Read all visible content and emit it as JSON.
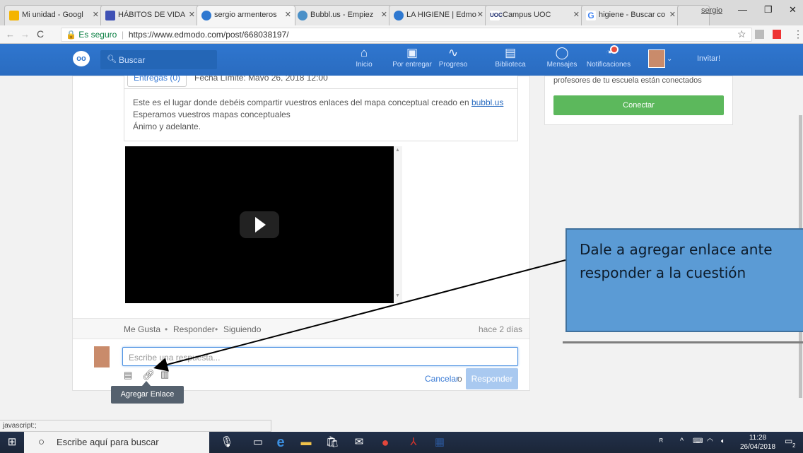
{
  "browser": {
    "tabs": [
      {
        "label": "Mi unidad - Googl",
        "icon": "drive-icon",
        "color": "#1fa463"
      },
      {
        "label": "HÁBITOS DE VIDA",
        "icon": "forms-icon",
        "color": "#3f51b5"
      },
      {
        "label": "sergio armenteros",
        "icon": "edmodo-icon",
        "color": "#2e78d0"
      },
      {
        "label": "Bubbl.us - Empiez",
        "icon": "bubbl-icon",
        "color": "#4a90c8"
      },
      {
        "label": "LA HIGIENE | Edmo",
        "icon": "edmodo-icon",
        "color": "#2e78d0"
      },
      {
        "label": "Campus UOC",
        "icon": "uoc-icon",
        "color": "#1a2a6c"
      },
      {
        "label": "higiene - Buscar co",
        "icon": "google-icon",
        "color": "#4285f4"
      }
    ],
    "user": "sergio",
    "secure_label": "Es seguro",
    "url": "https://www.edmodo.com/post/668038197/",
    "status_text": "javascript:;"
  },
  "nav": {
    "search_placeholder": "Buscar",
    "items": [
      {
        "label": "Inicio",
        "icon": "home-icon"
      },
      {
        "label": "Por entregar",
        "icon": "assignment-icon"
      },
      {
        "label": "Progreso",
        "icon": "progress-icon"
      },
      {
        "label": "Biblioteca",
        "icon": "library-icon"
      },
      {
        "label": "Mensajes",
        "icon": "message-icon"
      },
      {
        "label": "Notificaciones",
        "icon": "bell-icon"
      }
    ],
    "invite": "Invitar!"
  },
  "post": {
    "submissions_btn": "Entregas (0)",
    "due_date": "Fecha Límite: Mayo 26, 2018 12:00",
    "body_prefix": "Este es el lugar donde debéis compartir vuestros enlaces del mapa conceptual creado en ",
    "body_link": "bubbl.us",
    "line2": "Esperamos vuestros mapas conceptuales",
    "line3": "Ánimo y adelante.",
    "actions": {
      "like": "Me Gusta",
      "reply": "Responder",
      "follow": "Siguiendo",
      "sep": "•"
    },
    "time_ago": "hace 2 días",
    "reply_placeholder": "Escribe una respuesta...",
    "cancel": "Cancelar",
    "or": "o",
    "respond_btn": "Responder",
    "tooltip": "Agregar Enlace"
  },
  "sidebar": {
    "text": "profesores de tu escuela están conectados",
    "connect_btn": "Conectar"
  },
  "callout": {
    "line1": "Dale a agregar enlace ante",
    "line2": "responder a la cuestión"
  },
  "taskbar": {
    "search_placeholder": "Escribe aquí para buscar",
    "time": "11:28",
    "date": "26/04/2018",
    "notif_count": "2"
  },
  "colors": {
    "nav_blue": "#2e74cc",
    "connect_green": "#5cb85c",
    "respond_btn_disabled": "#a9c9f0",
    "callout_fill": "#5b9bd5"
  }
}
